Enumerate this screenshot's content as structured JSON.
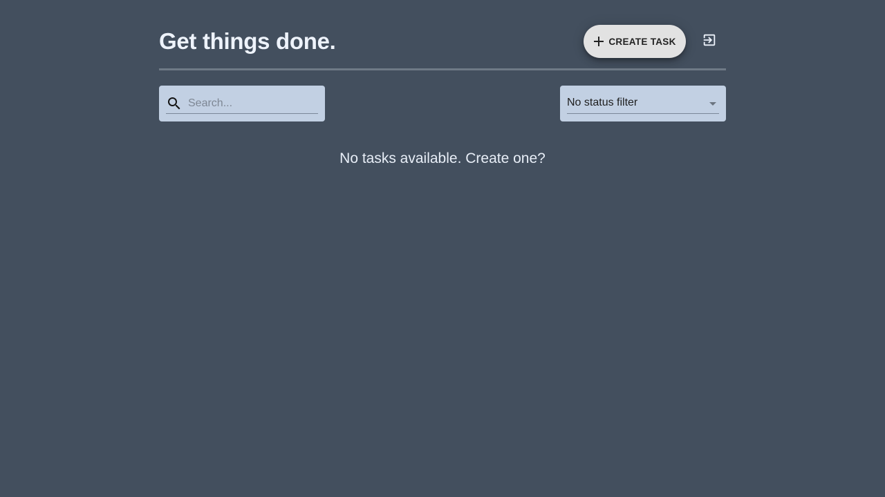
{
  "header": {
    "title": "Get things done.",
    "create_button_label": "CREATE TASK",
    "create_icon": "plus-icon",
    "logout_icon": "logout-icon"
  },
  "toolbar": {
    "search": {
      "placeholder": "Search...",
      "value": "",
      "icon": "search-icon"
    },
    "status_filter": {
      "selected": "No status filter",
      "icon": "chevron-down-icon"
    }
  },
  "main": {
    "empty_message": "No tasks available. Create one?"
  },
  "colors": {
    "background": "#434f5e",
    "field_background": "#c2d0e3",
    "button_background": "#e2e2e2",
    "title_text": "#eef3fb"
  }
}
